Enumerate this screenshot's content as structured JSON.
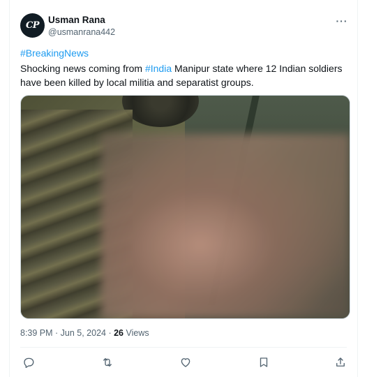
{
  "tweet": {
    "author_name": "Usman Rana",
    "author_handle": "@usmanrana442",
    "avatar_text": "CP",
    "hashtag_line": "#BreakingNews",
    "text_before_link": "Shocking news coming from ",
    "inline_hashtag": "#India",
    "text_after_link": " Manipur state where 12 Indian soldiers have been killed by local militia and separatist groups.",
    "time": "8:39 PM · Jun 5, 2024 · ",
    "views_count": "26",
    "views_label": " Views"
  },
  "icons": {
    "more": "more-options-icon",
    "reply": "reply-icon",
    "repost": "repost-icon",
    "like": "like-icon",
    "bookmark": "bookmark-icon",
    "share": "share-icon"
  },
  "colors": {
    "link": "#1d9bf0",
    "text": "#0f1419",
    "secondary": "#536471"
  }
}
